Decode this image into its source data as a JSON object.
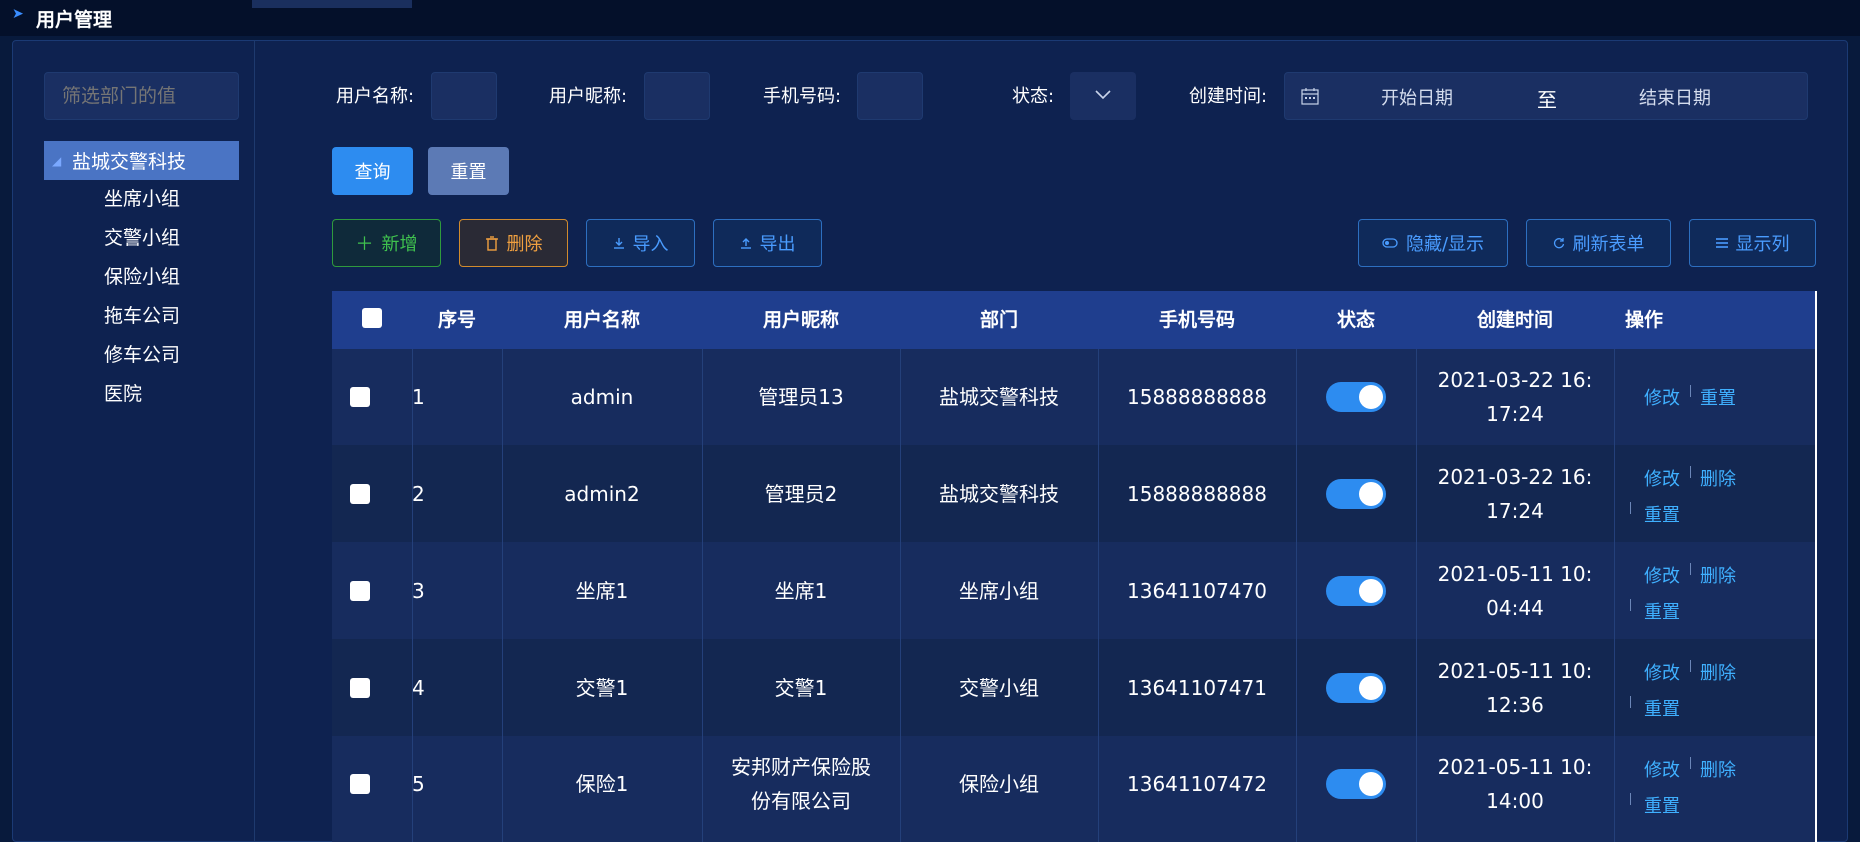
{
  "header": {
    "title": "用户管理"
  },
  "sidebar": {
    "filter_placeholder": "筛选部门的值",
    "root": "盐城交警科技",
    "children": [
      "坐席小组",
      "交警小组",
      "保险小组",
      "拖车公司",
      "修车公司",
      "医院"
    ]
  },
  "search": {
    "username_label": "用户名称:",
    "nickname_label": "用户昵称:",
    "phone_label": "手机号码:",
    "status_label": "状态:",
    "created_label": "创建时间:",
    "start_placeholder": "开始日期",
    "range_sep": "至",
    "end_placeholder": "结束日期",
    "query_button": "查询",
    "reset_button": "重置"
  },
  "toolbar": {
    "add": "新增",
    "delete": "删除",
    "import": "导入",
    "export": "导出",
    "toggle_search": "隐藏/显示",
    "refresh": "刷新表单",
    "columns": "显示列"
  },
  "table": {
    "headers": [
      "序号",
      "用户名称",
      "用户昵称",
      "部门",
      "手机号码",
      "状态",
      "创建时间",
      "操作"
    ],
    "rows": [
      {
        "id": "1",
        "username": "admin",
        "nickname": "管理员13",
        "dept": "盐城交警科技",
        "phone": "15888888888",
        "status": "on",
        "created_1": "2021-03-22 16:",
        "created_2": "17:24",
        "ops": [
          "修改",
          "重置"
        ]
      },
      {
        "id": "2",
        "username": "admin2",
        "nickname": "管理员2",
        "dept": "盐城交警科技",
        "phone": "15888888888",
        "status": "on",
        "created_1": "2021-03-22 16:",
        "created_2": "17:24",
        "ops": [
          "修改",
          "删除",
          "重置"
        ]
      },
      {
        "id": "3",
        "username": "坐席1",
        "nickname": "坐席1",
        "dept": "坐席小组",
        "phone": "13641107470",
        "status": "on",
        "created_1": "2021-05-11 10:",
        "created_2": "04:44",
        "ops": [
          "修改",
          "删除",
          "重置"
        ]
      },
      {
        "id": "4",
        "username": "交警1",
        "nickname": "交警1",
        "dept": "交警小组",
        "phone": "13641107471",
        "status": "on",
        "created_1": "2021-05-11 10:",
        "created_2": "12:36",
        "ops": [
          "修改",
          "删除",
          "重置"
        ]
      },
      {
        "id": "5",
        "username": "保险1",
        "nickname_1": "安邦财产保险股",
        "nickname_2": "份有限公司",
        "dept": "保险小组",
        "phone": "13641107472",
        "status": "on",
        "created_1": "2021-05-11 10:",
        "created_2": "14:00",
        "ops": [
          "修改",
          "删除",
          "重置"
        ]
      }
    ]
  },
  "colors": {
    "accent": "#2d8cf0",
    "link": "#3fb0ff",
    "header_bg": "#1f3e8e"
  }
}
